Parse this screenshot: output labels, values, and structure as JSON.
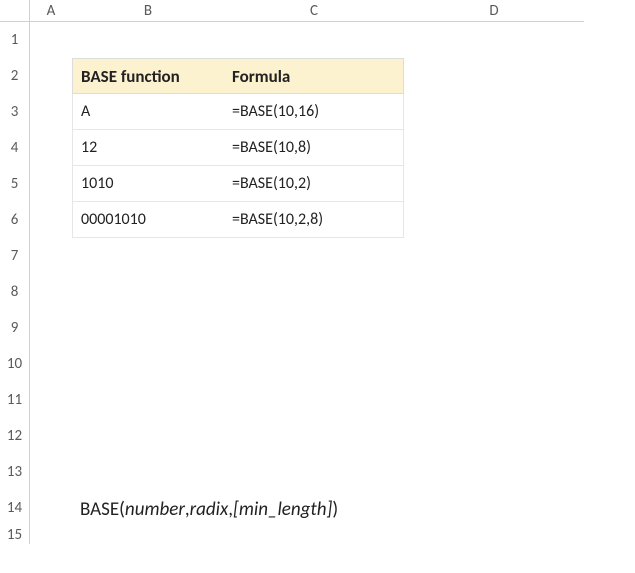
{
  "columns": [
    "A",
    "B",
    "C",
    "D"
  ],
  "rows": [
    "1",
    "2",
    "3",
    "4",
    "5",
    "6",
    "7",
    "8",
    "9",
    "10",
    "11",
    "12",
    "13",
    "14",
    "15"
  ],
  "table": {
    "headers": {
      "b": "BASE function",
      "c": "Formula"
    },
    "rows": [
      {
        "b": "A",
        "c": "=BASE(10,16)"
      },
      {
        "b": "12",
        "c": "=BASE(10,8)"
      },
      {
        "b": "1010",
        "c": "=BASE(10,2)"
      },
      {
        "b": "00001010",
        "c": "=BASE(10,2,8)"
      }
    ]
  },
  "syntax": {
    "fn_open": "BASE(",
    "arg1": "number",
    "sep1": " , ",
    "arg2": "radix",
    "sep2": ",  ",
    "arg3": "[min_length]",
    "close": " )"
  },
  "chart_data": {
    "type": "table",
    "title": "BASE function",
    "columns": [
      "BASE function",
      "Formula"
    ],
    "rows": [
      [
        "A",
        "=BASE(10,16)"
      ],
      [
        "12",
        "=BASE(10,8)"
      ],
      [
        "1010",
        "=BASE(10,2)"
      ],
      [
        "00001010",
        "=BASE(10,2,8)"
      ]
    ],
    "syntax": "BASE(number , radix, [min_length] )"
  }
}
